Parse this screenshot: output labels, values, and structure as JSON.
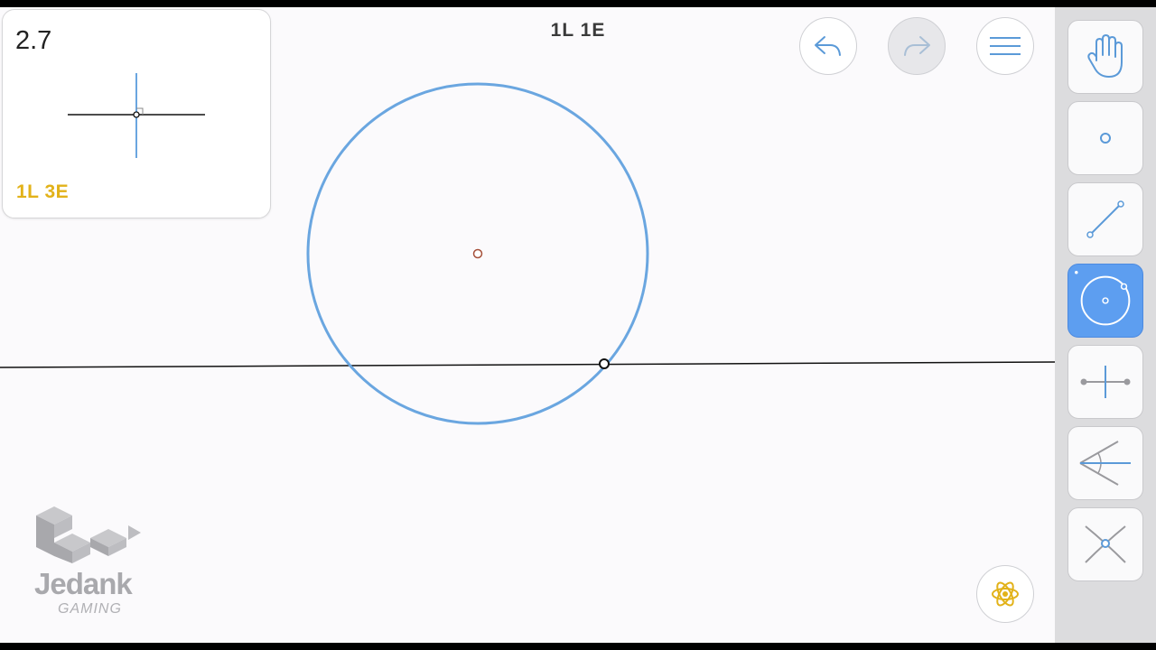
{
  "goal_card": {
    "level": "2.7",
    "score": "1L 3E"
  },
  "header": {
    "move_counter": "1L 1E"
  },
  "toolbar": {
    "undo": "undo-icon",
    "redo": "redo-icon",
    "menu": "menu-icon",
    "hint": "hint-icon"
  },
  "tools": [
    {
      "name": "move-tool",
      "icon": "hand-icon",
      "active": false
    },
    {
      "name": "point-tool",
      "icon": "point-icon",
      "active": false
    },
    {
      "name": "line-tool",
      "icon": "line-icon",
      "active": false
    },
    {
      "name": "circle-tool",
      "icon": "circle-icon",
      "active": true
    },
    {
      "name": "perpendicular-bisector-tool",
      "icon": "perpendicular-bisector-icon",
      "active": false
    },
    {
      "name": "angle-bisector-tool",
      "icon": "angle-bisector-icon",
      "active": false
    },
    {
      "name": "intersect-tool",
      "icon": "intersect-icon",
      "active": false
    }
  ],
  "watermark": {
    "brand": "Jedank",
    "sub": "GAMING"
  },
  "colors": {
    "accent_blue": "#6aa6e0",
    "score_yellow": "#e2b219",
    "center_point": "#a5503a",
    "active_tool": "#5d9ef0"
  }
}
